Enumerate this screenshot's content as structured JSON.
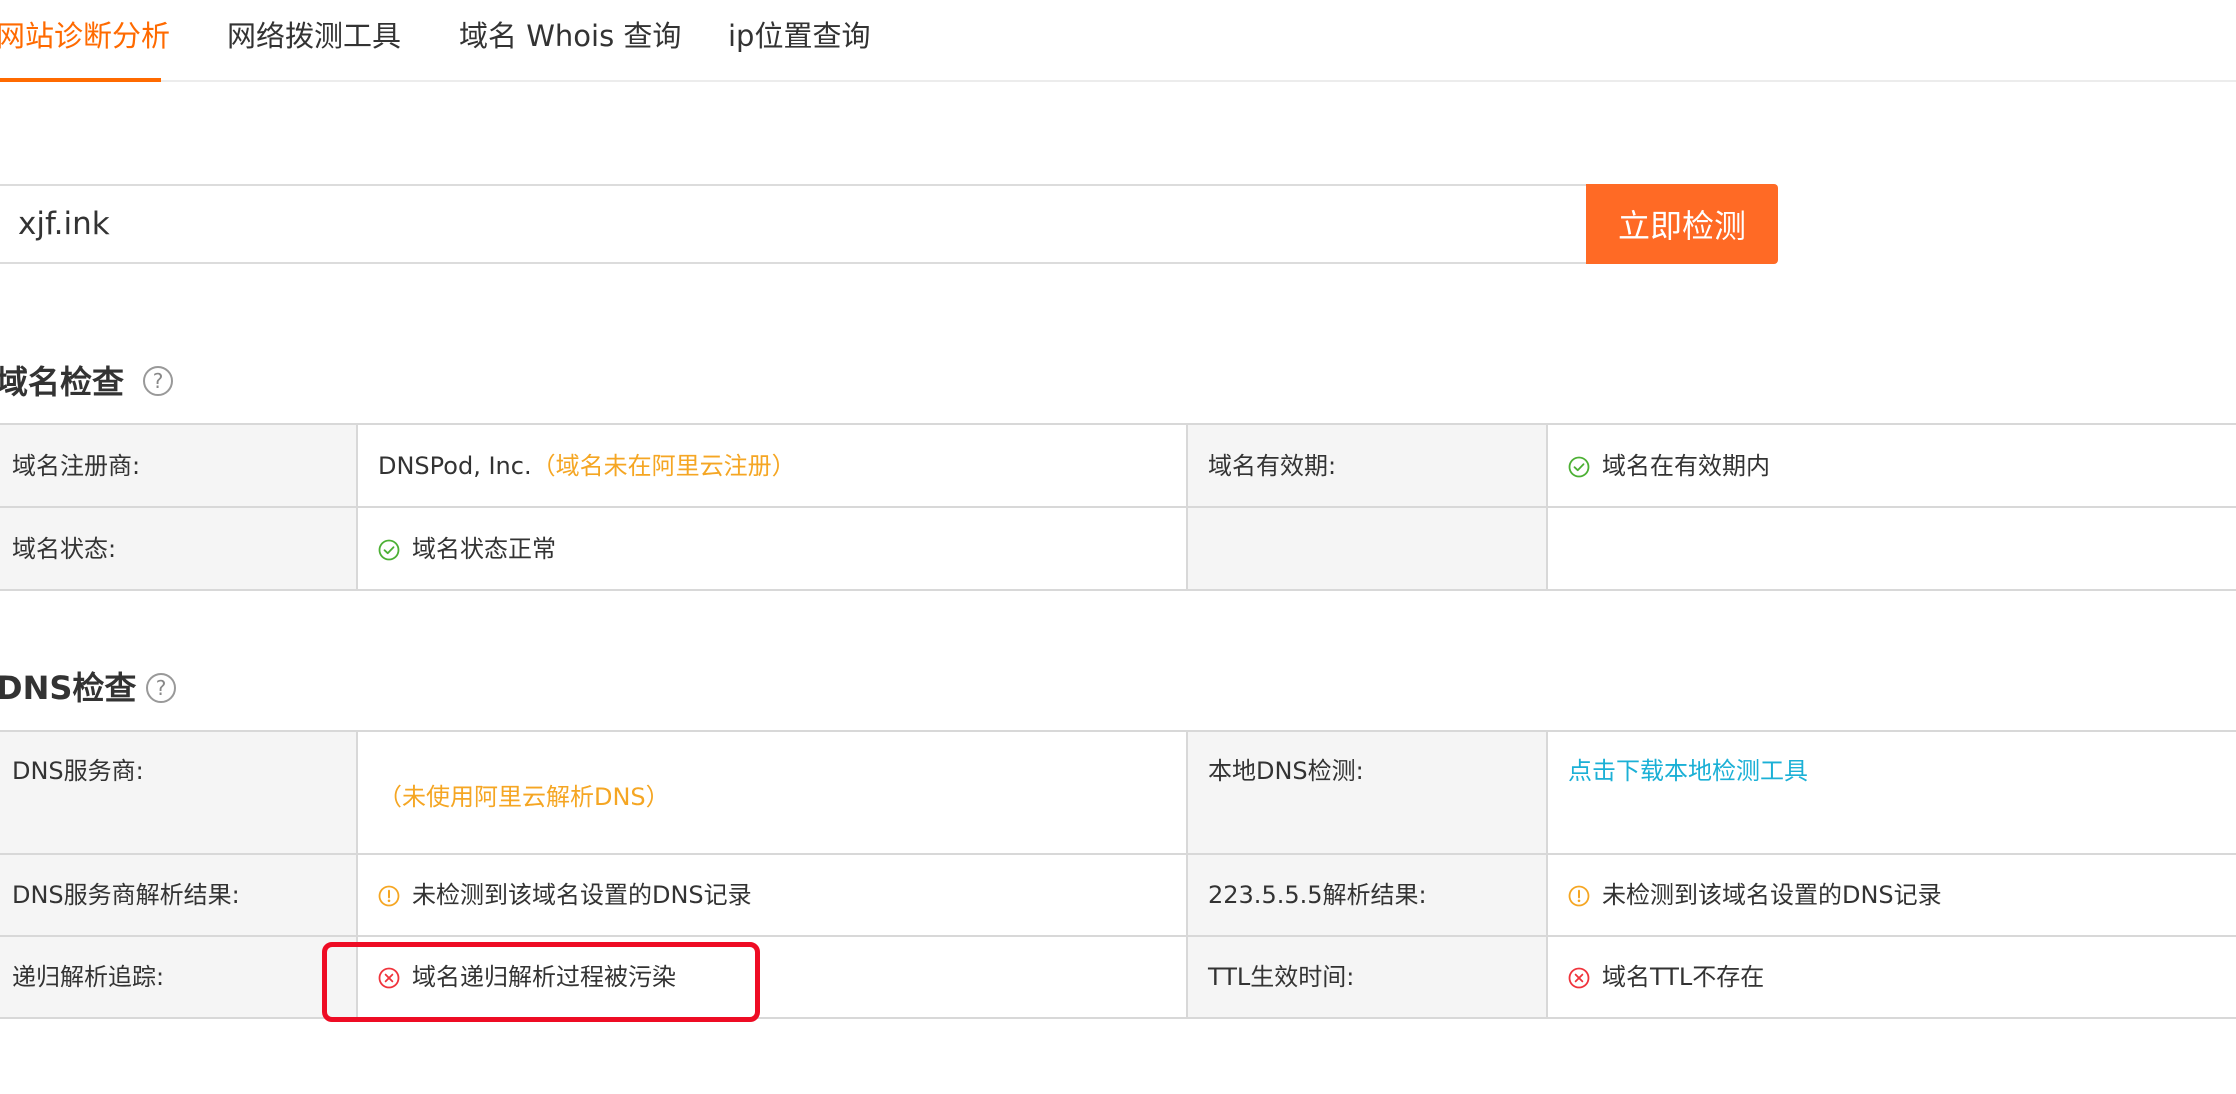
{
  "tabs": [
    {
      "label": "网站诊断分析",
      "active": true
    },
    {
      "label": "网络拨测工具",
      "active": false
    },
    {
      "label": "域名 Whois 查询",
      "active": false
    },
    {
      "label": "ip位置查询",
      "active": false
    }
  ],
  "search": {
    "value": "xjf.ink",
    "button_label": "立即检测"
  },
  "domain_check": {
    "title": "域名检查",
    "help_glyph": "?",
    "rows": [
      {
        "label1": "域名注册商:",
        "value1_main": "DNSPod, Inc.",
        "value1_note": "（域名未在阿里云注册）",
        "label2": "域名有效期:",
        "value2": "域名在有效期内"
      },
      {
        "label1": "域名状态:",
        "value1": "域名状态正常",
        "label2": "",
        "value2": ""
      }
    ]
  },
  "dns_check": {
    "title": "DNS检查",
    "help_glyph": "?",
    "rows": [
      {
        "label1": "DNS服务商:",
        "value1_note": "（未使用阿里云解析DNS）",
        "label2": "本地DNS检测:",
        "value2_link": "点击下载本地检测工具"
      },
      {
        "label1": "DNS服务商解析结果:",
        "value1": "未检测到该域名设置的DNS记录",
        "label2": "223.5.5.5解析结果:",
        "value2": "未检测到该域名设置的DNS记录"
      },
      {
        "label1": "递归解析追踪:",
        "value1": "域名递归解析过程被污染",
        "label2": "TTL生效时间:",
        "value2": "域名TTL不存在"
      }
    ]
  },
  "colors": {
    "accent": "#ff6a00",
    "button": "#ff6a25",
    "success": "#4cb034",
    "warning": "#f5a623",
    "error": "#f0343c",
    "link": "#1bb0d6",
    "highlight": "#ee0c24"
  },
  "icons": {
    "success": "check-circle-icon",
    "warning": "exclamation-circle-icon",
    "error": "cross-circle-icon",
    "help": "question-circle-icon"
  }
}
